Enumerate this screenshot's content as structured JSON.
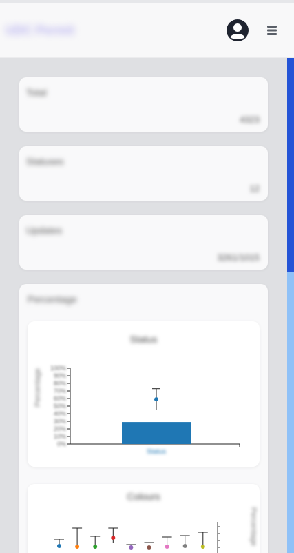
{
  "header": {
    "brand": "UDC Permit",
    "user_icon": "user-circle-icon",
    "menu_icon": "hamburger-menu-icon"
  },
  "stats": [
    {
      "title": "Total",
      "value": "4323"
    },
    {
      "title": "Statuses",
      "value": "12"
    },
    {
      "title": "Updates",
      "value": "3261/1015"
    }
  ],
  "section": {
    "title": "Percentage"
  },
  "charts": [
    {
      "title": "Status",
      "ylabel": "Percentage",
      "x_category": "Status",
      "bar_color": "#1f77b4"
    },
    {
      "title": "Colours",
      "ylabel": "Percentage"
    }
  ],
  "colors": {
    "scroll_thumb": "#2453d6",
    "scroll_track": "#8fc1f7",
    "bar": "#1f77b4"
  },
  "chart_data": [
    {
      "type": "bar",
      "title": "Status",
      "categories": [
        "Status"
      ],
      "values": [
        29
      ],
      "error_point": {
        "value": 59,
        "low": 45,
        "high": 73
      },
      "ylim": [
        0,
        100
      ],
      "yunit": "%"
    },
    {
      "type": "scatter",
      "title": "Colours",
      "series": [
        {
          "value": 2,
          "low": 0,
          "high": 12,
          "color": "#1f77b4"
        },
        {
          "value": 1,
          "low": 0,
          "high": 28,
          "color": "#ff7f0e"
        },
        {
          "value": 1,
          "low": 0,
          "high": 16,
          "color": "#2ca02c"
        },
        {
          "value": 14,
          "low": 7,
          "high": 28,
          "color": "#d62728"
        },
        {
          "value": 0,
          "low": 0,
          "high": 4,
          "color": "#9467bd"
        },
        {
          "value": 0,
          "low": 0,
          "high": 7,
          "color": "#8c564b"
        },
        {
          "value": 1,
          "low": 0,
          "high": 15,
          "color": "#e377c2"
        },
        {
          "value": 2,
          "low": 0,
          "high": 17,
          "color": "#7f7f7f"
        },
        {
          "value": 1,
          "low": 0,
          "high": 22,
          "color": "#bcbd22"
        }
      ]
    }
  ]
}
